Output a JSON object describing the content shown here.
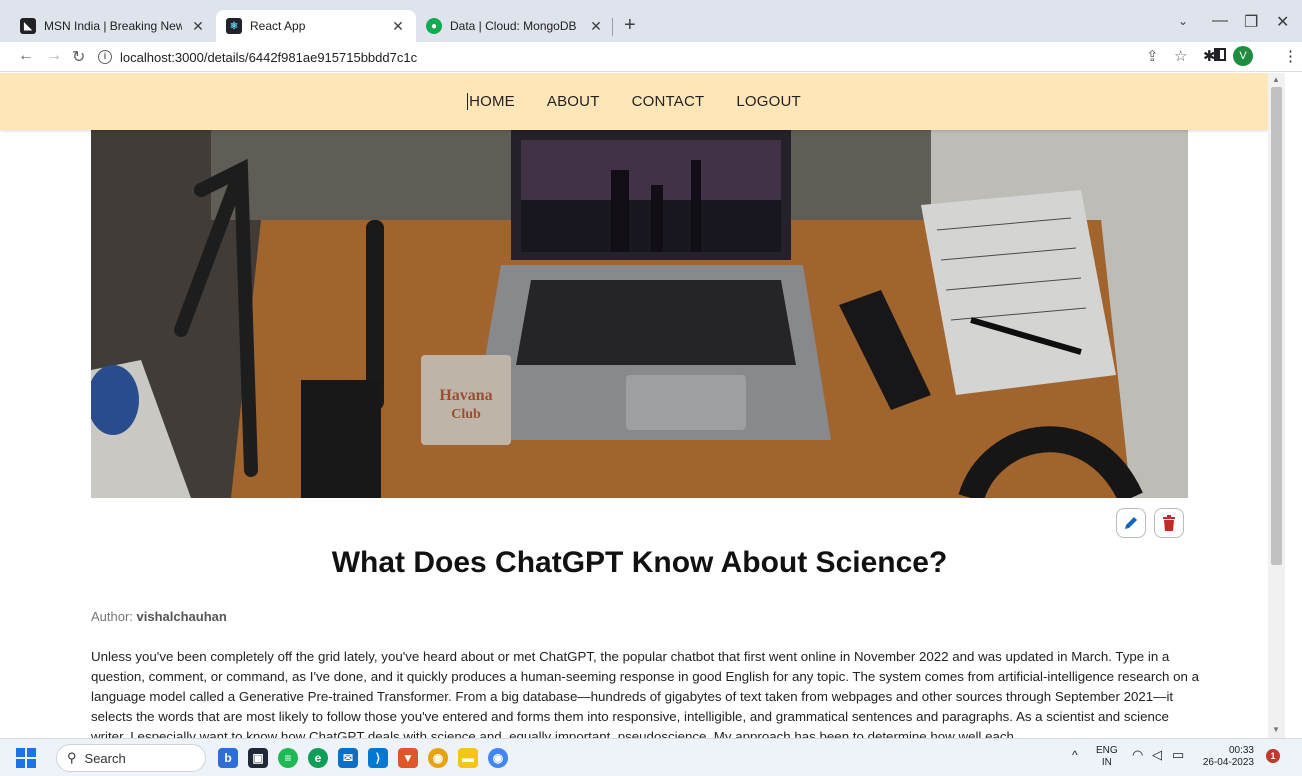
{
  "browser": {
    "tabs": [
      {
        "title": "MSN India | Breaking News, Ente",
        "active": false
      },
      {
        "title": "React App",
        "active": true
      },
      {
        "title": "Data | Cloud: MongoDB Cloud",
        "active": false
      }
    ],
    "new_tab_icon": "plus-icon",
    "url": "localhost:3000/details/6442f981ae915715bbdd7c1c",
    "profile_initial": "V"
  },
  "site_nav": {
    "items": [
      "HOME",
      "ABOUT",
      "CONTACT",
      "LOGOUT"
    ]
  },
  "post": {
    "title": "What Does ChatGPT Know About Science?",
    "author_label": "Author: ",
    "author_name": "vishalchauhan",
    "body": "Unless you've been completely off the grid lately, you've heard about or met ChatGPT, the popular chatbot that first went online in November 2022 and was updated in March. Type in a question, comment, or command, as I've done, and it quickly produces a human-seeming response in good English for any topic. The system comes from artificial-intelligence research on a language model called a Generative Pre-trained Transformer. From a big database—hundreds of gigabytes of text taken from webpages and other sources through September 2021—it selects the words that are most likely to follow those you've entered and forms them into responsive, intelligible, and grammatical sentences and paragraphs. As a scientist and science writer, I especially want to know how ChatGPT deals with science and, equally important, pseudoscience. My approach has been to determine how well each",
    "hero_badge": {
      "line1": "Havana",
      "line2": "Club"
    }
  },
  "taskbar": {
    "search_label": "Search",
    "lang_line1": "ENG",
    "lang_line2": "IN",
    "time": "00:33",
    "date": "26-04-2023",
    "notification_count": "1"
  },
  "colors": {
    "nav_bg": "#ffe6b8",
    "tabstrip_bg": "#dfe3eb",
    "delete_red": "#c62828",
    "edit_blue": "#1565c0"
  }
}
